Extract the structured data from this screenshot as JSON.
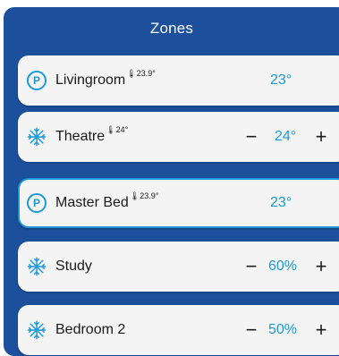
{
  "panel": {
    "title": "Zones"
  },
  "zones": [
    {
      "name": "Livingroom",
      "reading": "🌡23.9°",
      "mode_icon": "p-icon",
      "value": "23°",
      "has_stepper": false
    },
    {
      "name": "Theatre",
      "reading": "🌡24°",
      "mode_icon": "snowflake-icon",
      "value": "24°",
      "has_stepper": true
    },
    {
      "name": "Master Bed",
      "reading": "🌡23.9°",
      "mode_icon": "p-icon",
      "value": "23°",
      "has_stepper": false,
      "selected": true
    },
    {
      "name": "Study",
      "reading": "",
      "mode_icon": "snowflake-icon",
      "value": "60%",
      "has_stepper": true
    },
    {
      "name": "Bedroom 2",
      "reading": "",
      "mode_icon": "snowflake-icon",
      "value": "50%",
      "has_stepper": true
    }
  ],
  "labels": {
    "p_icon": "P",
    "minus": "−",
    "plus": "+"
  },
  "colors": {
    "panel_bg": "#1c4f9c",
    "card_bg": "#f4f4f4",
    "accent": "#1d99d6"
  }
}
